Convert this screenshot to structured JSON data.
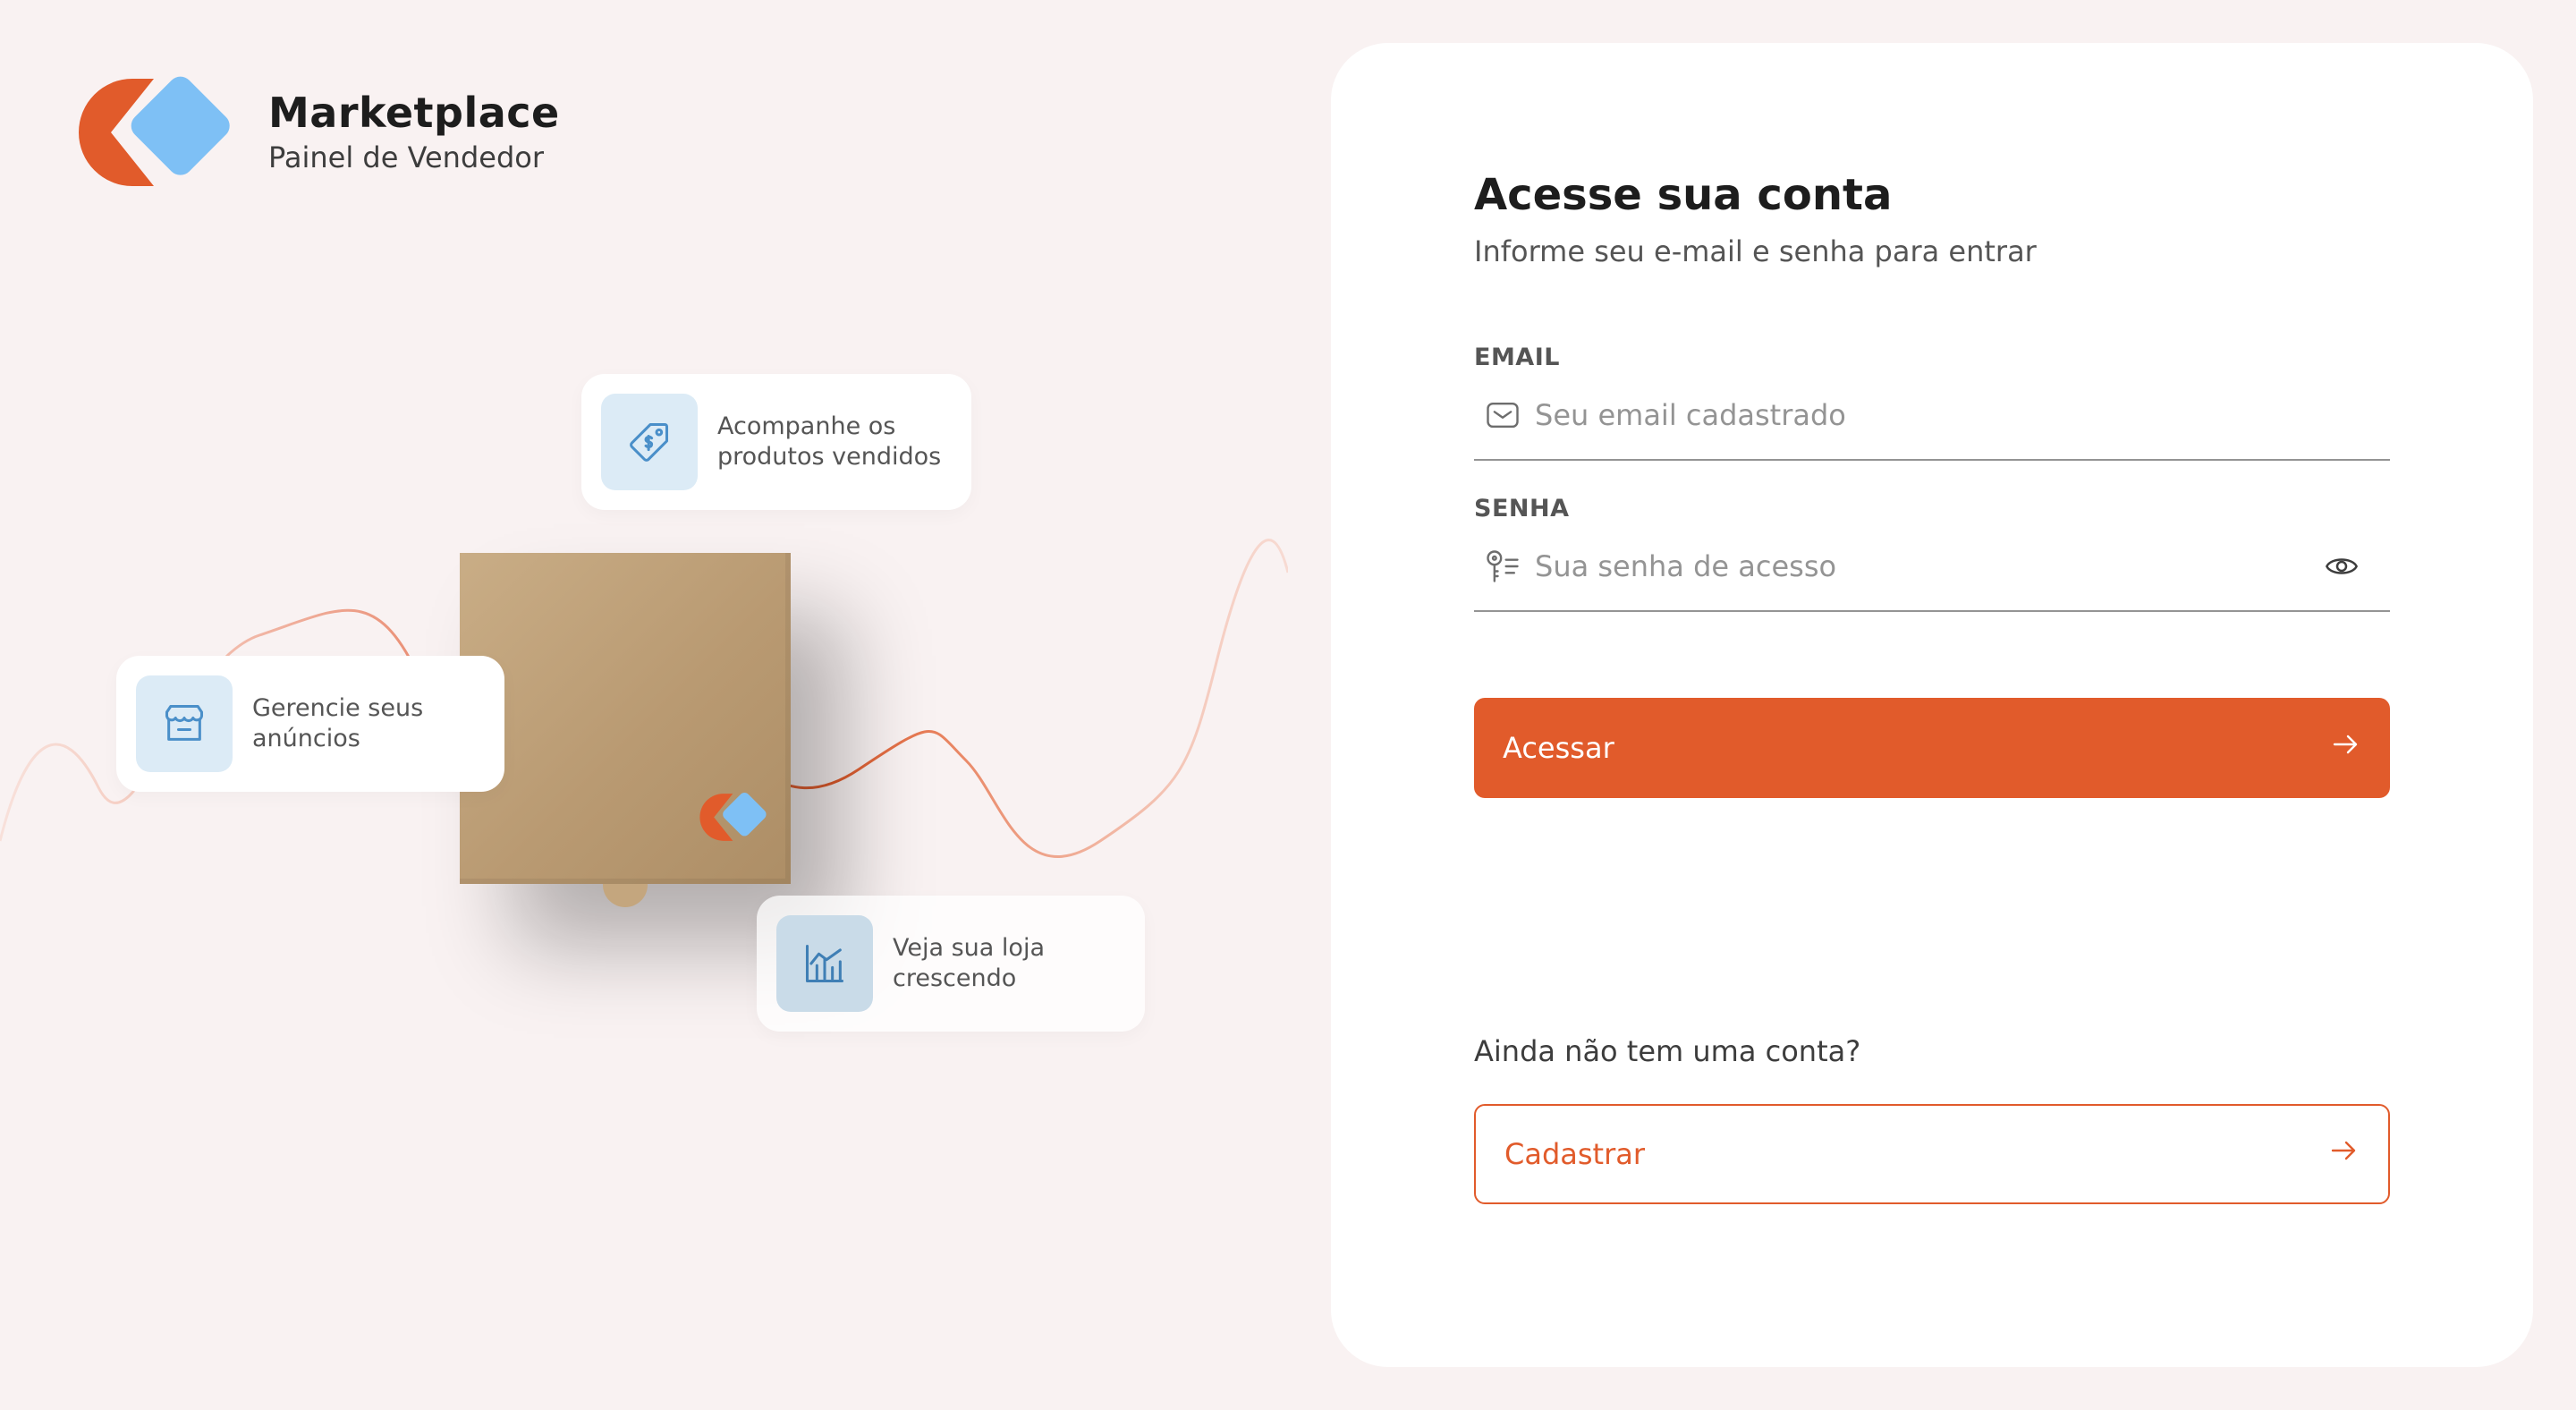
{
  "brand": {
    "title": "Marketplace",
    "subtitle": "Painel de Vendedor",
    "colors": {
      "orange": "#e15b2b",
      "blue": "#7ec0f5"
    }
  },
  "hero": {
    "features": [
      {
        "icon": "tag-icon",
        "text": "Acompanhe os\nprodutos vendidos"
      },
      {
        "icon": "store-icon",
        "text": "Gerencie seus\nanúncios"
      },
      {
        "icon": "chart-icon",
        "text": "Veja sua loja\ncrescendo"
      }
    ]
  },
  "login": {
    "title": "Acesse sua conta",
    "subtitle": "Informe seu e-mail e senha para entrar",
    "email": {
      "label": "EMAIL",
      "placeholder": "Seu email cadastrado",
      "value": "",
      "icon": "mail-icon"
    },
    "password": {
      "label": "SENHA",
      "placeholder": "Sua senha de acesso",
      "value": "",
      "icon": "key-icon",
      "toggle_icon": "eye-icon"
    },
    "submit_label": "Acessar",
    "signup_question": "Ainda não tem uma conta?",
    "signup_label": "Cadastrar"
  },
  "theme": {
    "accent": "#e15b2b",
    "background": "#f9f2f2",
    "panel": "#ffffff",
    "icon_tile": "#dcebf6",
    "icon_stroke": "#4a8fc9"
  }
}
